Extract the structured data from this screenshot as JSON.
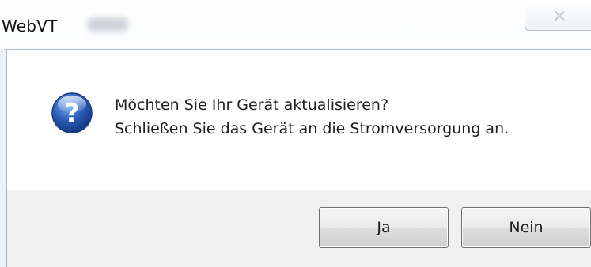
{
  "window": {
    "title": "WebVT",
    "close_glyph": "✕"
  },
  "dialog": {
    "icon": "question-icon",
    "message_line1": "Möchten Sie Ihr Gerät aktualisieren?",
    "message_line2": "Schließen Sie das Gerät an die Stromversorgung an."
  },
  "buttons": {
    "yes_label": "Ja",
    "no_label": "Nein"
  },
  "colors": {
    "icon_blue": "#2a5cb8",
    "footer_bg": "#f0f0f0",
    "button_border": "#707070"
  }
}
